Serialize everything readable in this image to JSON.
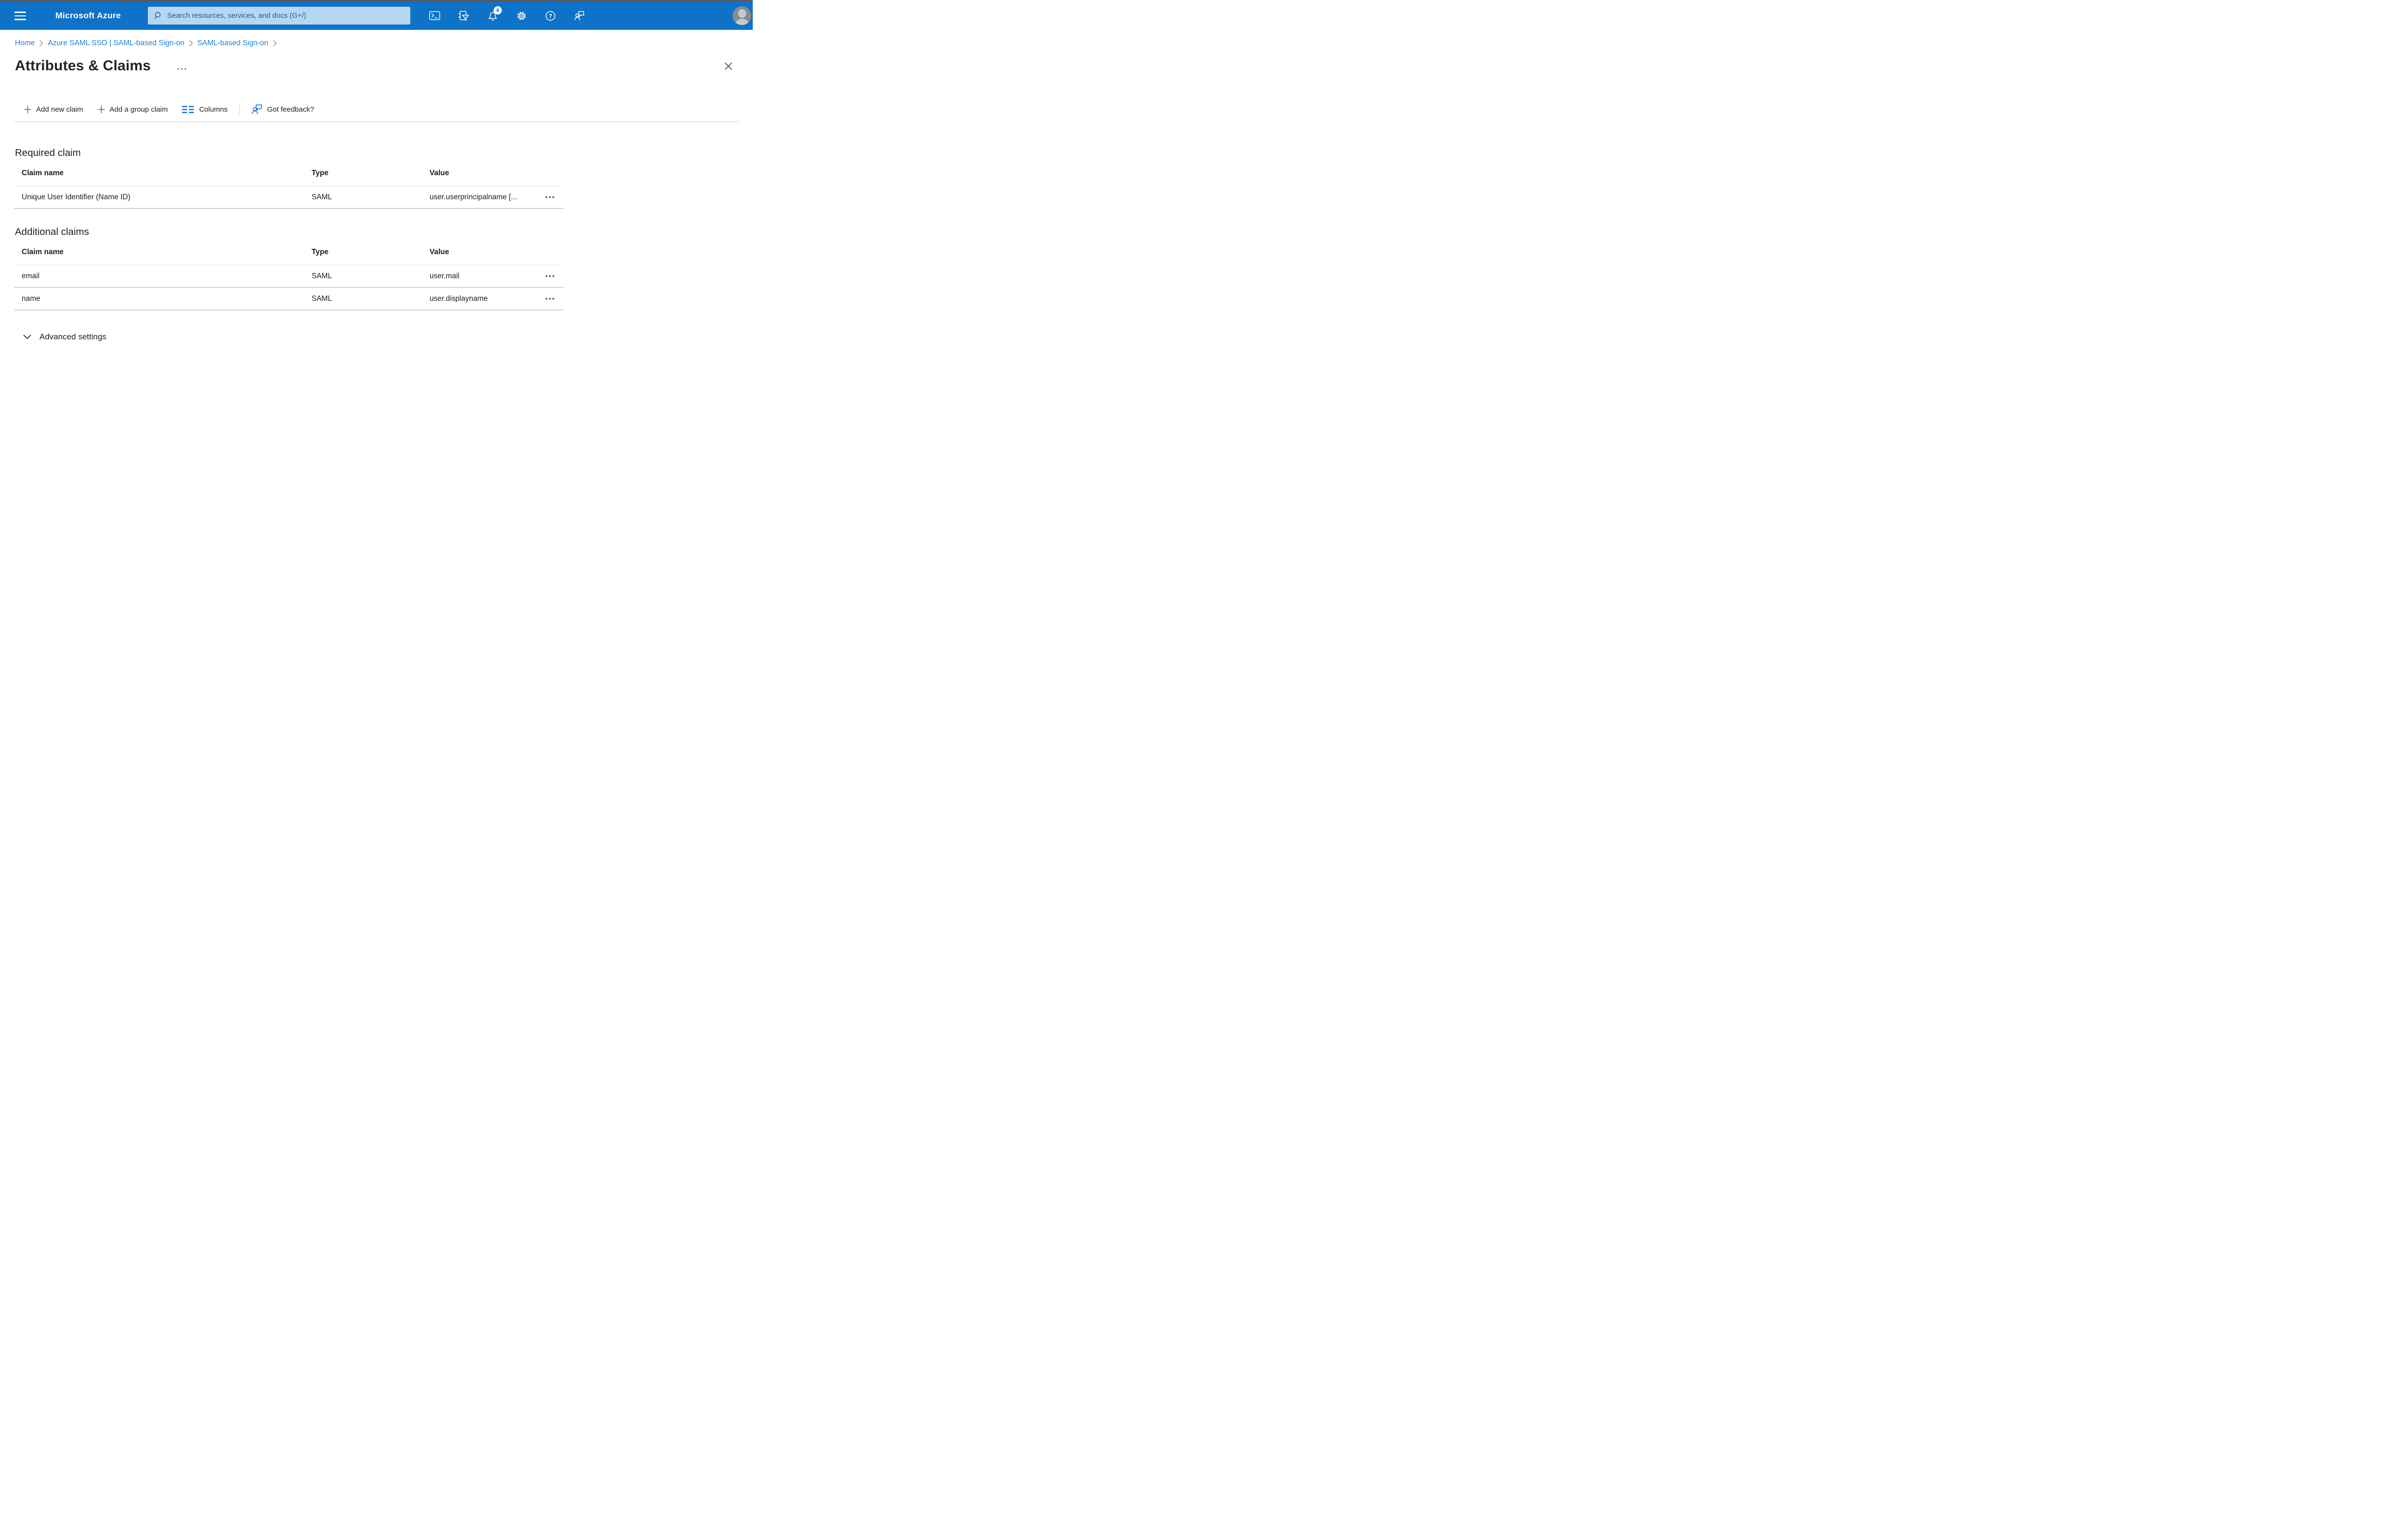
{
  "topbar": {
    "brand": "Microsoft Azure",
    "search_placeholder": "Search resources, services, and docs (G+/)",
    "notification_count": "6"
  },
  "breadcrumb": {
    "items": [
      {
        "label": "Home"
      },
      {
        "label": "Azure SAML SSO | SAML-based Sign-on"
      },
      {
        "label": "SAML-based Sign-on"
      }
    ]
  },
  "page": {
    "title": "Attributes & Claims"
  },
  "toolbar": {
    "add_new_claim": "Add new claim",
    "add_group_claim": "Add a group claim",
    "columns": "Columns",
    "got_feedback": "Got feedback?"
  },
  "required_claim": {
    "heading": "Required claim",
    "columns": [
      "Claim name",
      "Type",
      "Value"
    ],
    "rows": [
      {
        "claim_name": "Unique User Identifier (Name ID)",
        "type": "SAML",
        "value": "user.userprincipalname [..."
      }
    ]
  },
  "additional_claims": {
    "heading": "Additional claims",
    "columns": [
      "Claim name",
      "Type",
      "Value"
    ],
    "rows": [
      {
        "claim_name": "email",
        "type": "SAML",
        "value": "user.mail"
      },
      {
        "claim_name": "name",
        "type": "SAML",
        "value": "user.displayname"
      }
    ]
  },
  "advanced_settings": {
    "label": "Advanced settings"
  },
  "icons": {
    "title_ellipsis": "···",
    "more_options": "•••"
  },
  "colors": {
    "topbar_blue": "#0e72c8",
    "search_bg": "#b6d6f2",
    "search_text": "#1c5b99",
    "breadcrumb_link": "#1d80d7",
    "accent_blue": "#1374cc",
    "text": "#21201f",
    "header_divider": "#e7e7e7",
    "row_divider": "#d2d0ce"
  }
}
